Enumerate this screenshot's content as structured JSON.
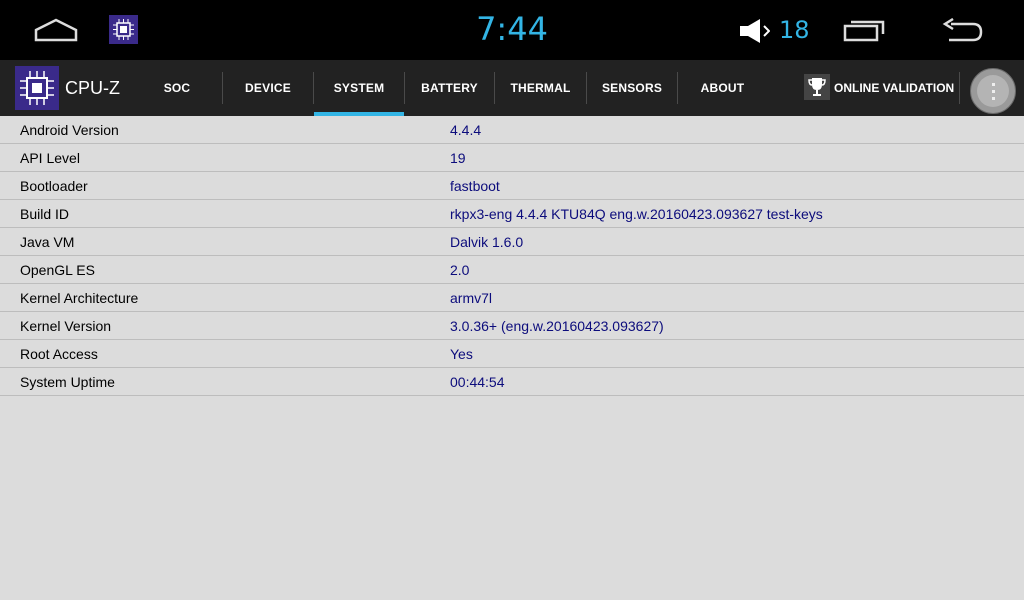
{
  "statusbar": {
    "time": "7:44",
    "volume": "18"
  },
  "appbar": {
    "title": "CPU-Z",
    "tabs": [
      {
        "label": "SOC",
        "active": false
      },
      {
        "label": "DEVICE",
        "active": false
      },
      {
        "label": "SYSTEM",
        "active": true
      },
      {
        "label": "BATTERY",
        "active": false
      },
      {
        "label": "THERMAL",
        "active": false
      },
      {
        "label": "SENSORS",
        "active": false
      },
      {
        "label": "ABOUT",
        "active": false
      }
    ],
    "online_validation": "ONLINE VALIDATION"
  },
  "system": {
    "rows": [
      {
        "key": "Android Version",
        "value": "4.4.4"
      },
      {
        "key": "API Level",
        "value": "19"
      },
      {
        "key": "Bootloader",
        "value": "fastboot"
      },
      {
        "key": "Build ID",
        "value": "rkpx3-eng 4.4.4 KTU84Q eng.w.20160423.093627 test-keys"
      },
      {
        "key": "Java VM",
        "value": "Dalvik 1.6.0"
      },
      {
        "key": "OpenGL ES",
        "value": "2.0"
      },
      {
        "key": "Kernel Architecture",
        "value": "armv7l"
      },
      {
        "key": "Kernel Version",
        "value": "3.0.36+ (eng.w.20160423.093627)"
      },
      {
        "key": "Root Access",
        "value": "Yes"
      },
      {
        "key": "System Uptime",
        "value": "00:44:54"
      }
    ]
  },
  "colors": {
    "accent": "#33b5e5",
    "value_text": "#0c0c7c",
    "brand": "#3a2a8a"
  }
}
